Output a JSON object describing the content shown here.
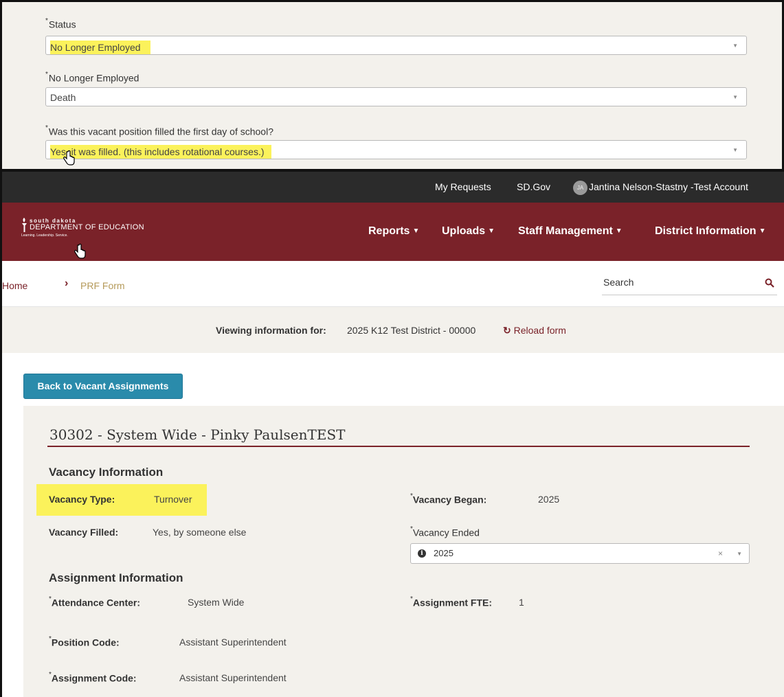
{
  "inset": {
    "status_label": "Status",
    "status_value": "No Longer Employed",
    "nle_label": "No Longer Employed",
    "nle_value": "Death",
    "filled_label": "Was this vacant position filled the first day of school?",
    "filled_value": "Yes, it was filled. (this includes rotational courses.)"
  },
  "topbar": {
    "my_requests": "My Requests",
    "sd_gov": "SD.Gov",
    "avatar_initials": "JA",
    "user_name": "Jantina Nelson-Stastny -Test Account"
  },
  "logo": {
    "line1": "south dakota",
    "line2": "DEPARTMENT OF EDUCATION",
    "line3": "Learning. Leadership. Service."
  },
  "nav": {
    "reports": "Reports",
    "uploads": "Uploads",
    "staff_management": "Staff Management",
    "district_information": "District Information"
  },
  "breadcrumb": {
    "home": "Home",
    "current": "PRF Form"
  },
  "search": {
    "label": "Search"
  },
  "viewing": {
    "label": "Viewing information for:",
    "value": "2025 K12 Test District - 00000",
    "reload": "Reload form"
  },
  "back_button": "Back to Vacant Assignments",
  "card": {
    "title": "30302 - System Wide - Pinky PaulsenTEST",
    "vacancy_section": "Vacancy Information",
    "vacancy_type_label": "Vacancy Type:",
    "vacancy_type_value": "Turnover",
    "vacancy_filled_label": "Vacancy Filled:",
    "vacancy_filled_value": "Yes, by someone else",
    "vacancy_began_label": "Vacancy Began:",
    "vacancy_began_value": "2025",
    "vacancy_ended_label": "Vacancy Ended",
    "vacancy_ended_value": "2025",
    "assignment_section": "Assignment Information",
    "attendance_center_label": "Attendance Center:",
    "attendance_center_value": "System Wide",
    "assignment_fte_label": "Assignment FTE:",
    "assignment_fte_value": "1",
    "position_code_label": "Position Code:",
    "position_code_value": "Assistant Superintendent",
    "assignment_code_label": "Assignment Code:",
    "assignment_code_value": "Assistant Superintendent"
  },
  "colors": {
    "brand": "#7a2229",
    "button": "#2a8bab",
    "highlight": "#fbf25b",
    "panel": "#f3f1ec"
  }
}
